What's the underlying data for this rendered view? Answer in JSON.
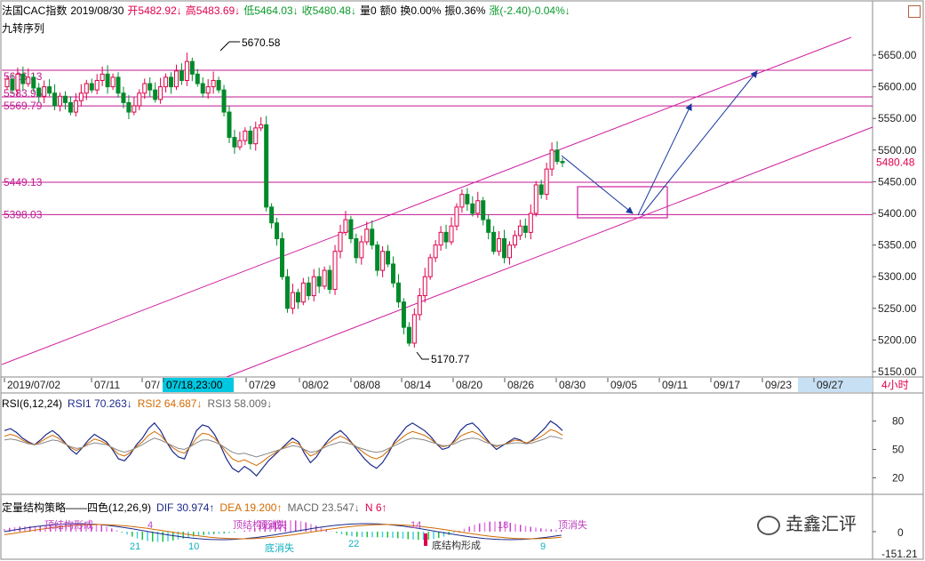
{
  "header": {
    "name": "法国CAC指数",
    "date": "2019/08/30",
    "open": "开5482.92↓",
    "high": "高5483.69↓",
    "low": "低5464.03↓",
    "close": "收5480.48↓",
    "volume": "量0",
    "amount": "额0",
    "turnover": "换0.00%",
    "amplitude": "振0.36%",
    "change": "涨(-2.40)-0.04%↓"
  },
  "subtitle": "九转序列",
  "price_axis": {
    "ticks": [
      "5650.00",
      "5600.00",
      "5550.00",
      "5500.00",
      "5450.00",
      "5400.00",
      "5350.00",
      "5300.00",
      "5250.00",
      "5200.00",
      "5150.00"
    ],
    "last_price": "5480.48"
  },
  "levels": [
    "5626.13",
    "5583.96",
    "5569.79",
    "5449.13",
    "5398.03"
  ],
  "annotations": {
    "high_label": "5670.58",
    "low_label": "5170.77"
  },
  "time_axis": {
    "labels": [
      "2019/07/02",
      "07/11",
      "07/",
      "07/18,23:00",
      "07/29",
      "08/02",
      "08/08",
      "08/14",
      "08/20",
      "08/26",
      "08/30",
      "09/05",
      "09/11",
      "09/17",
      "09/23",
      "09/27"
    ],
    "period": "4小时"
  },
  "rsi": {
    "title": "RSI(6,12,24)",
    "rsi1": "RSI1 70.263↓",
    "rsi2": "RSI2 64.687↓",
    "rsi3": "RSI3 58.009↓",
    "ticks": [
      "80",
      "50",
      "20"
    ]
  },
  "macd": {
    "title": "定量结构策略——四色(12,26,9)",
    "dif": "DIF 30.974↑",
    "dea": "DEA 19.200↑",
    "macd": "MACD 23.547↓",
    "n": "N 6↑",
    "ticks": [
      "0",
      "-151.21"
    ],
    "markers": [
      {
        "text": "顶结构形成",
        "color": "#c040c0"
      },
      {
        "text": "4",
        "color": "#c040c0"
      },
      {
        "text": "21",
        "color": "#10b0c0"
      },
      {
        "text": "10",
        "color": "#10b0c0"
      },
      {
        "text": "顶结构形成",
        "color": "#c040c0"
      },
      {
        "text": "顶消失",
        "color": "#c040c0"
      },
      {
        "text": "底消失",
        "color": "#10b0c0"
      },
      {
        "text": "22",
        "color": "#10b0c0"
      },
      {
        "text": "14",
        "color": "#c040c0"
      },
      {
        "text": "底结构形成",
        "color": "#333333"
      },
      {
        "text": "18",
        "color": "#c040c0"
      },
      {
        "text": "9",
        "color": "#10b0c0"
      },
      {
        "text": "顶消失",
        "color": "#c040c0"
      }
    ]
  },
  "watermark": "垚鑫汇评",
  "colors": {
    "up": "#e0004a",
    "down": "#008a2a",
    "channel": "#d020a0",
    "arrow": "#1a3aa0",
    "level": "#c01890"
  },
  "chart_data": {
    "type": "candlestick",
    "title": "法国CAC指数",
    "ylim": [
      5140,
      5690
    ],
    "x_labels": [
      "2019/07/02",
      "07/11",
      "07/18",
      "07/29",
      "08/02",
      "08/08",
      "08/14",
      "08/20",
      "08/26",
      "08/30",
      "09/05",
      "09/11",
      "09/17",
      "09/23",
      "09/27"
    ],
    "period": "4小时",
    "candles": [
      [
        5600,
        5612
      ],
      [
        5612,
        5595
      ],
      [
        5595,
        5620
      ],
      [
        5620,
        5605
      ],
      [
        5605,
        5615
      ],
      [
        5615,
        5598
      ],
      [
        5598,
        5585
      ],
      [
        5585,
        5600
      ],
      [
        5600,
        5590
      ],
      [
        5590,
        5570
      ],
      [
        5570,
        5585
      ],
      [
        5585,
        5575
      ],
      [
        5575,
        5560
      ],
      [
        5560,
        5578
      ],
      [
        5578,
        5590
      ],
      [
        5590,
        5605
      ],
      [
        5605,
        5595
      ],
      [
        5595,
        5610
      ],
      [
        5610,
        5620
      ],
      [
        5620,
        5600
      ],
      [
        5600,
        5615
      ],
      [
        5615,
        5590
      ],
      [
        5590,
        5575
      ],
      [
        5575,
        5560
      ],
      [
        5560,
        5570
      ],
      [
        5570,
        5590
      ],
      [
        5590,
        5605
      ],
      [
        5605,
        5595
      ],
      [
        5595,
        5580
      ],
      [
        5580,
        5600
      ],
      [
        5600,
        5615
      ],
      [
        5615,
        5600
      ],
      [
        5600,
        5625
      ],
      [
        5625,
        5610
      ],
      [
        5610,
        5640
      ],
      [
        5640,
        5620
      ],
      [
        5620,
        5605
      ],
      [
        5605,
        5590
      ],
      [
        5590,
        5600
      ],
      [
        5600,
        5610
      ],
      [
        5610,
        5595
      ],
      [
        5595,
        5560
      ],
      [
        5560,
        5520
      ],
      [
        5520,
        5505
      ],
      [
        5505,
        5515
      ],
      [
        5515,
        5530
      ],
      [
        5530,
        5510
      ],
      [
        5510,
        5535
      ],
      [
        5535,
        5540
      ],
      [
        5540,
        5410
      ],
      [
        5410,
        5385
      ],
      [
        5385,
        5360
      ],
      [
        5360,
        5300
      ],
      [
        5300,
        5250
      ],
      [
        5250,
        5275
      ],
      [
        5275,
        5260
      ],
      [
        5260,
        5290
      ],
      [
        5290,
        5270
      ],
      [
        5270,
        5300
      ],
      [
        5300,
        5285
      ],
      [
        5285,
        5310
      ],
      [
        5310,
        5280
      ],
      [
        5280,
        5340
      ],
      [
        5340,
        5370
      ],
      [
        5370,
        5390
      ],
      [
        5390,
        5360
      ],
      [
        5360,
        5330
      ],
      [
        5330,
        5355
      ],
      [
        5355,
        5375
      ],
      [
        5375,
        5350
      ],
      [
        5350,
        5310
      ],
      [
        5310,
        5340
      ],
      [
        5340,
        5320
      ],
      [
        5320,
        5290
      ],
      [
        5290,
        5260
      ],
      [
        5260,
        5220
      ],
      [
        5220,
        5195
      ],
      [
        5195,
        5240
      ],
      [
        5240,
        5270
      ],
      [
        5270,
        5300
      ],
      [
        5300,
        5330
      ],
      [
        5330,
        5350
      ],
      [
        5350,
        5370
      ],
      [
        5370,
        5355
      ],
      [
        5355,
        5380
      ],
      [
        5380,
        5410
      ],
      [
        5410,
        5430
      ],
      [
        5430,
        5415
      ],
      [
        5415,
        5400
      ],
      [
        5400,
        5420
      ],
      [
        5420,
        5390
      ],
      [
        5390,
        5370
      ],
      [
        5370,
        5340
      ],
      [
        5340,
        5360
      ],
      [
        5360,
        5330
      ],
      [
        5330,
        5350
      ],
      [
        5350,
        5365
      ],
      [
        5365,
        5380
      ],
      [
        5380,
        5370
      ],
      [
        5370,
        5400
      ],
      [
        5400,
        5445
      ],
      [
        5445,
        5430
      ],
      [
        5430,
        5470
      ],
      [
        5470,
        5500
      ],
      [
        5500,
        5482
      ],
      [
        5482,
        5480
      ]
    ],
    "channel_upper": [
      [
        0,
        5162
      ],
      [
        1,
        5678
      ]
    ],
    "levels": [
      5626.13,
      5583.96,
      5569.79,
      5449.13,
      5398.03
    ],
    "rsi_ylim": [
      10,
      90
    ],
    "rsi_ticks": [
      80,
      50,
      20
    ],
    "rsi1": [
      70,
      72,
      68,
      62,
      58,
      55,
      60,
      66,
      70,
      65,
      58,
      50,
      45,
      52,
      60,
      66,
      62,
      58,
      50,
      40,
      38,
      45,
      55,
      62,
      72,
      78,
      70,
      58,
      48,
      42,
      40,
      55,
      70,
      76,
      74,
      66,
      54,
      40,
      30,
      26,
      32,
      28,
      22,
      30,
      38,
      44,
      50,
      56,
      62,
      58,
      46,
      36,
      42,
      52,
      60,
      66,
      70,
      64,
      56,
      48,
      40,
      34,
      30,
      36,
      46,
      58,
      66,
      74,
      78,
      74,
      70,
      64,
      56,
      50,
      52,
      60,
      70,
      76,
      78,
      72,
      64,
      56,
      50,
      54,
      58,
      62,
      60,
      56,
      60,
      66,
      72,
      80,
      76,
      70
    ],
    "rsi2": [
      64,
      66,
      64,
      60,
      57,
      55,
      58,
      62,
      65,
      62,
      57,
      52,
      49,
      52,
      57,
      61,
      59,
      56,
      51,
      45,
      43,
      47,
      53,
      58,
      65,
      69,
      65,
      58,
      52,
      48,
      46,
      53,
      62,
      67,
      66,
      62,
      55,
      47,
      40,
      37,
      39,
      36,
      33,
      37,
      42,
      46,
      50,
      54,
      58,
      56,
      49,
      43,
      46,
      52,
      57,
      61,
      64,
      61,
      56,
      51,
      46,
      42,
      40,
      43,
      49,
      56,
      61,
      66,
      69,
      67,
      65,
      61,
      56,
      53,
      54,
      58,
      64,
      67,
      69,
      66,
      61,
      56,
      53,
      55,
      57,
      60,
      59,
      57,
      59,
      62,
      66,
      71,
      69,
      65
    ],
    "rsi3": [
      60,
      61,
      60,
      58,
      56,
      55,
      56,
      58,
      60,
      59,
      56,
      53,
      51,
      52,
      55,
      57,
      56,
      55,
      52,
      49,
      47,
      49,
      52,
      55,
      59,
      62,
      60,
      57,
      54,
      51,
      50,
      53,
      57,
      60,
      60,
      58,
      55,
      51,
      47,
      45,
      46,
      44,
      42,
      44,
      46,
      48,
      50,
      52,
      54,
      53,
      50,
      47,
      48,
      51,
      54,
      56,
      58,
      57,
      55,
      52,
      50,
      48,
      47,
      48,
      51,
      54,
      57,
      60,
      62,
      61,
      60,
      58,
      56,
      54,
      54,
      56,
      59,
      61,
      62,
      61,
      58,
      56,
      54,
      55,
      56,
      57,
      57,
      56,
      57,
      59,
      61,
      64,
      63,
      61
    ]
  }
}
